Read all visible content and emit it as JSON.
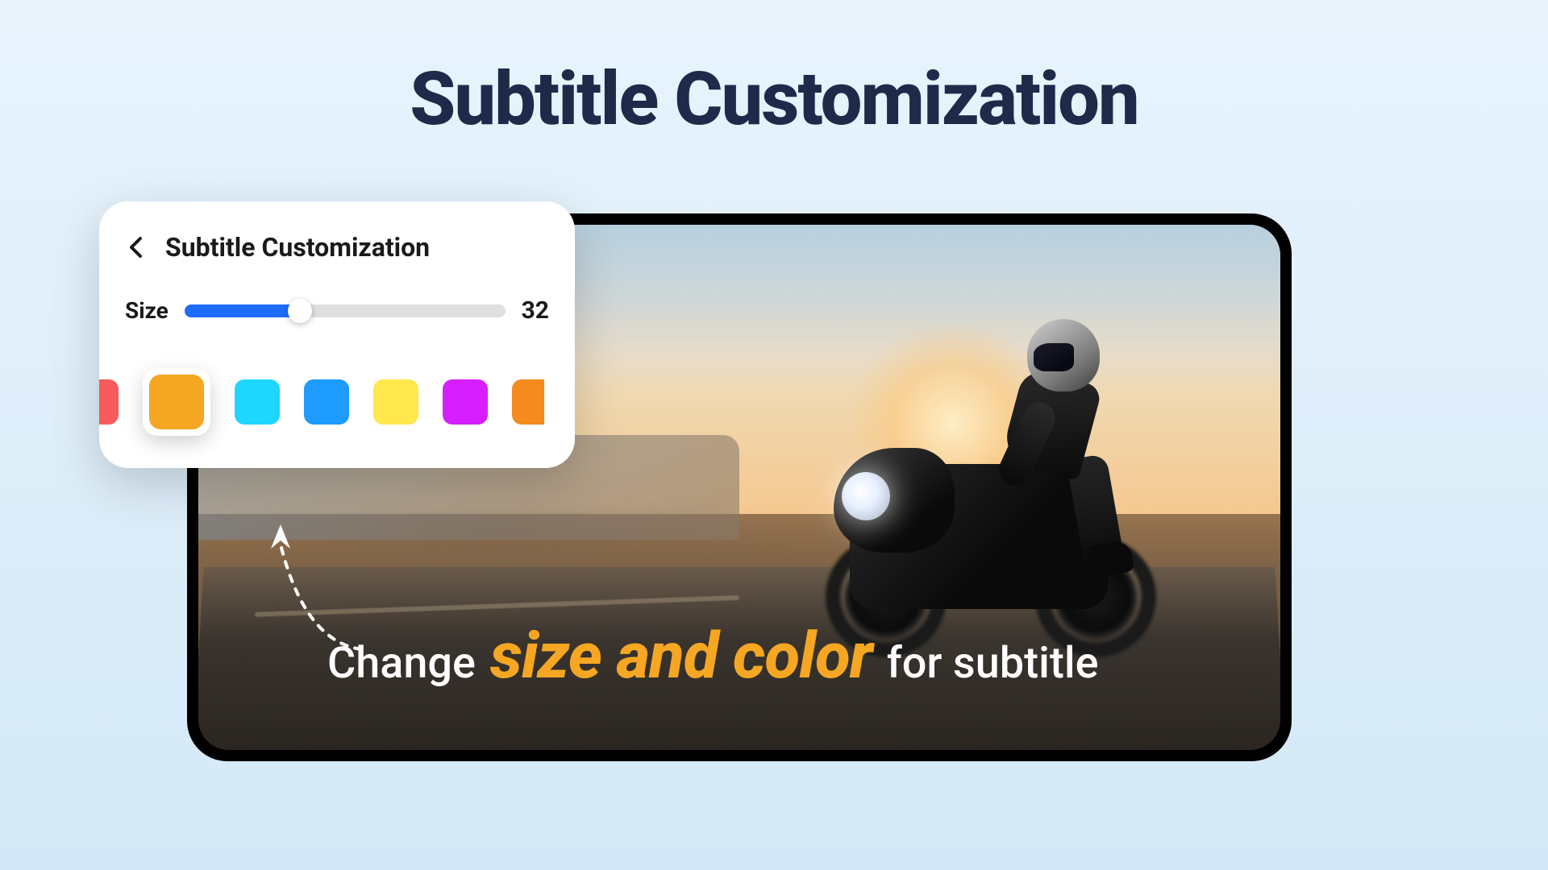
{
  "main_title": "Subtitle Customization",
  "panel": {
    "title": "Subtitle Customization",
    "size_label": "Size",
    "size_value": "32",
    "slider_percent": 36,
    "colors": [
      {
        "hex": "#f75b5b",
        "partial": "left"
      },
      {
        "hex": "#f5a623",
        "selected": true
      },
      {
        "hex": "#1ed6ff"
      },
      {
        "hex": "#1e9bff"
      },
      {
        "hex": "#ffe84d"
      },
      {
        "hex": "#d61eff"
      },
      {
        "hex": "#f58a1e",
        "partial": "right"
      }
    ]
  },
  "caption": {
    "pre": "Change",
    "highlight": "size and color",
    "post": "for subtitle"
  }
}
